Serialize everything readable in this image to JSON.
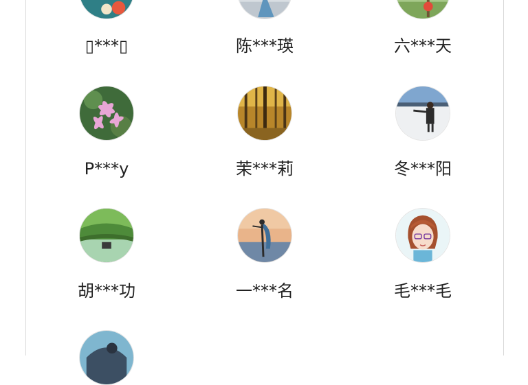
{
  "users": [
    {
      "name": "▯***▯",
      "avatar": "teal-scenery-avatar"
    },
    {
      "name": "陈***瑛",
      "avatar": "person-in-blue-dress-avatar"
    },
    {
      "name": "六***天",
      "avatar": "green-field-avatar"
    },
    {
      "name": "P***y",
      "avatar": "pink-flowers-avatar"
    },
    {
      "name": "茉***莉",
      "avatar": "autumn-forest-avatar"
    },
    {
      "name": "冬***阳",
      "avatar": "snow-field-person-avatar"
    },
    {
      "name": "胡***功",
      "avatar": "garden-path-avatar"
    },
    {
      "name": "一***名",
      "avatar": "sunset-dancer-avatar"
    },
    {
      "name": "毛***毛",
      "avatar": "cartoon-girl-avatar"
    },
    {
      "name": "",
      "avatar": "sky-scenery-avatar"
    }
  ]
}
